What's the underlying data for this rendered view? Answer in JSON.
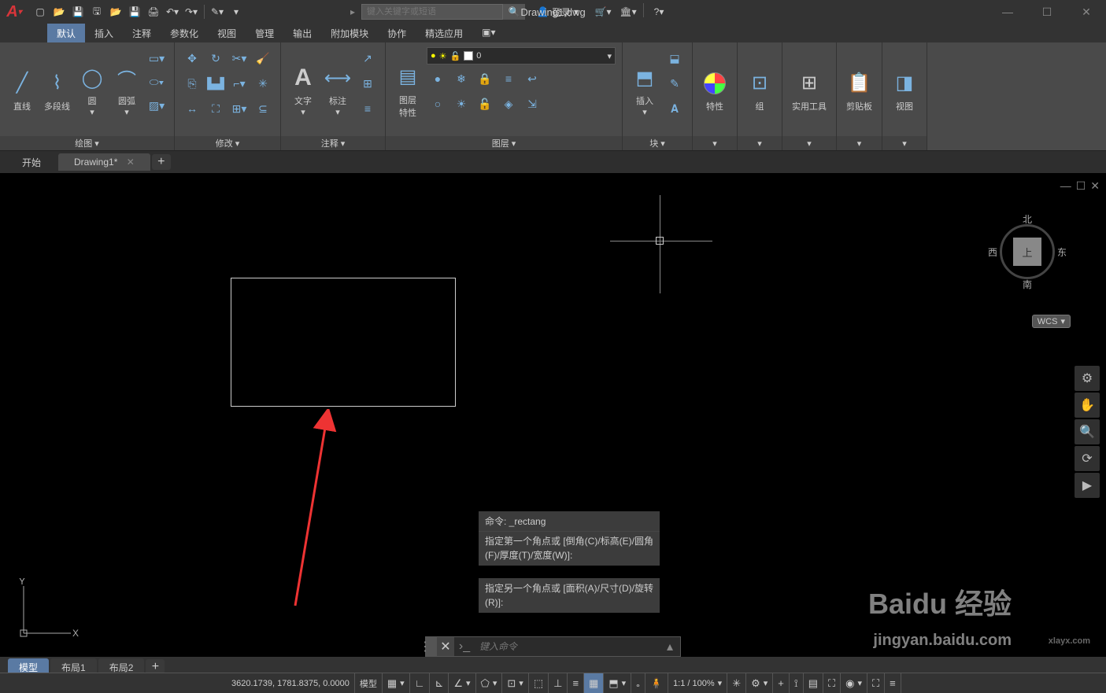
{
  "title": "Drawing1.dwg",
  "search_placeholder": "键入关键字或短语",
  "login_label": "登录",
  "menu_tabs": [
    "默认",
    "插入",
    "注释",
    "参数化",
    "视图",
    "管理",
    "输出",
    "附加模块",
    "协作",
    "精选应用"
  ],
  "active_menu_tab": 0,
  "ribbon": {
    "draw": {
      "label": "绘图",
      "line": "直线",
      "pline": "多段线",
      "circle": "圆",
      "arc": "圆弧"
    },
    "modify": {
      "label": "修改"
    },
    "annot": {
      "label": "注释",
      "text": "文字",
      "dim": "标注"
    },
    "layers": {
      "label": "图层",
      "props": "图层\n特性",
      "current": "0"
    },
    "block": {
      "label": "块",
      "insert": "插入"
    },
    "props": {
      "label": "特性"
    },
    "group": {
      "label": "组"
    },
    "utils": {
      "label": "实用工具"
    },
    "clip": {
      "label": "剪贴板"
    },
    "view": {
      "label": "视图"
    }
  },
  "doc_tabs": {
    "start": "开始",
    "active": "Drawing1*"
  },
  "viewcube": {
    "n": "北",
    "s": "南",
    "e": "东",
    "w": "西",
    "top": "上"
  },
  "wcs": "WCS",
  "cmd_history": {
    "line1": "命令: _rectang",
    "line2": "指定第一个角点或 [倒角(C)/标高(E)/圆角(F)/厚度(T)/宽度(W)]:",
    "line3": "指定另一个角点或 [面积(A)/尺寸(D)/旋转(R)]:"
  },
  "cmd_input_placeholder": "键入命令",
  "layout_tabs": [
    "模型",
    "布局1",
    "布局2"
  ],
  "status": {
    "coords": "3620.1739, 1781.8375, 0.0000",
    "space": "模型",
    "scale": "1:1 / 100%"
  },
  "ucs": {
    "x": "X",
    "y": "Y"
  },
  "watermarks": {
    "baidu": "Baidu 经验",
    "url": "jingyan.baidu.com",
    "xiayx": "xlayx.com"
  }
}
